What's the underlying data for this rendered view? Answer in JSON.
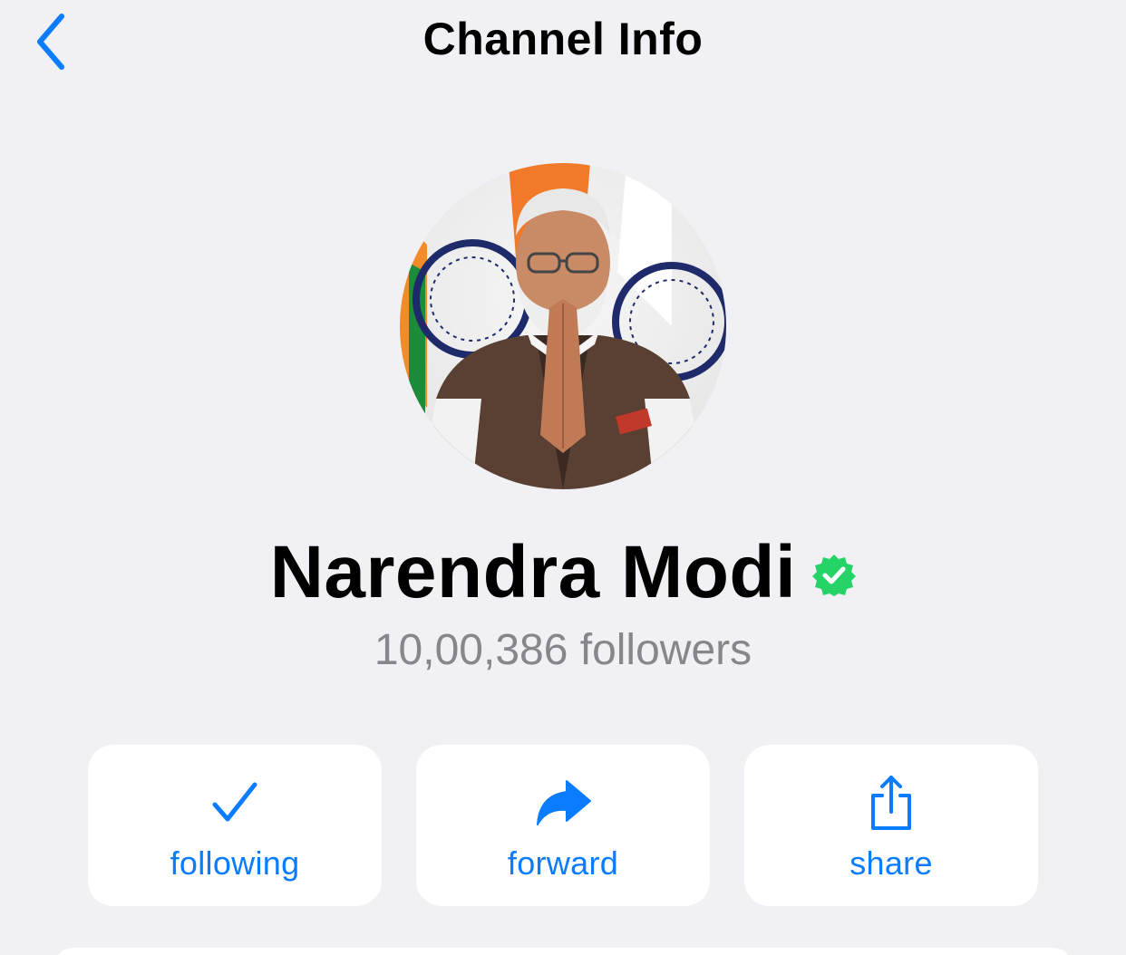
{
  "nav": {
    "title": "Channel Info",
    "back_icon": "chevron-left-icon"
  },
  "channel": {
    "name": "Narendra Modi",
    "verified_icon": "verified-badge-icon",
    "followers": "10,00,386 followers",
    "avatar": "profile-photo"
  },
  "actions": [
    {
      "label": "following",
      "icon": "checkmark-icon"
    },
    {
      "label": "forward",
      "icon": "forward-arrow-icon"
    },
    {
      "label": "share",
      "icon": "share-icon"
    }
  ],
  "colors": {
    "background": "#f0f0f5",
    "accent": "#0a7cff",
    "verified": "#25d366",
    "secondary_text": "#86868b",
    "card": "#ffffff"
  }
}
